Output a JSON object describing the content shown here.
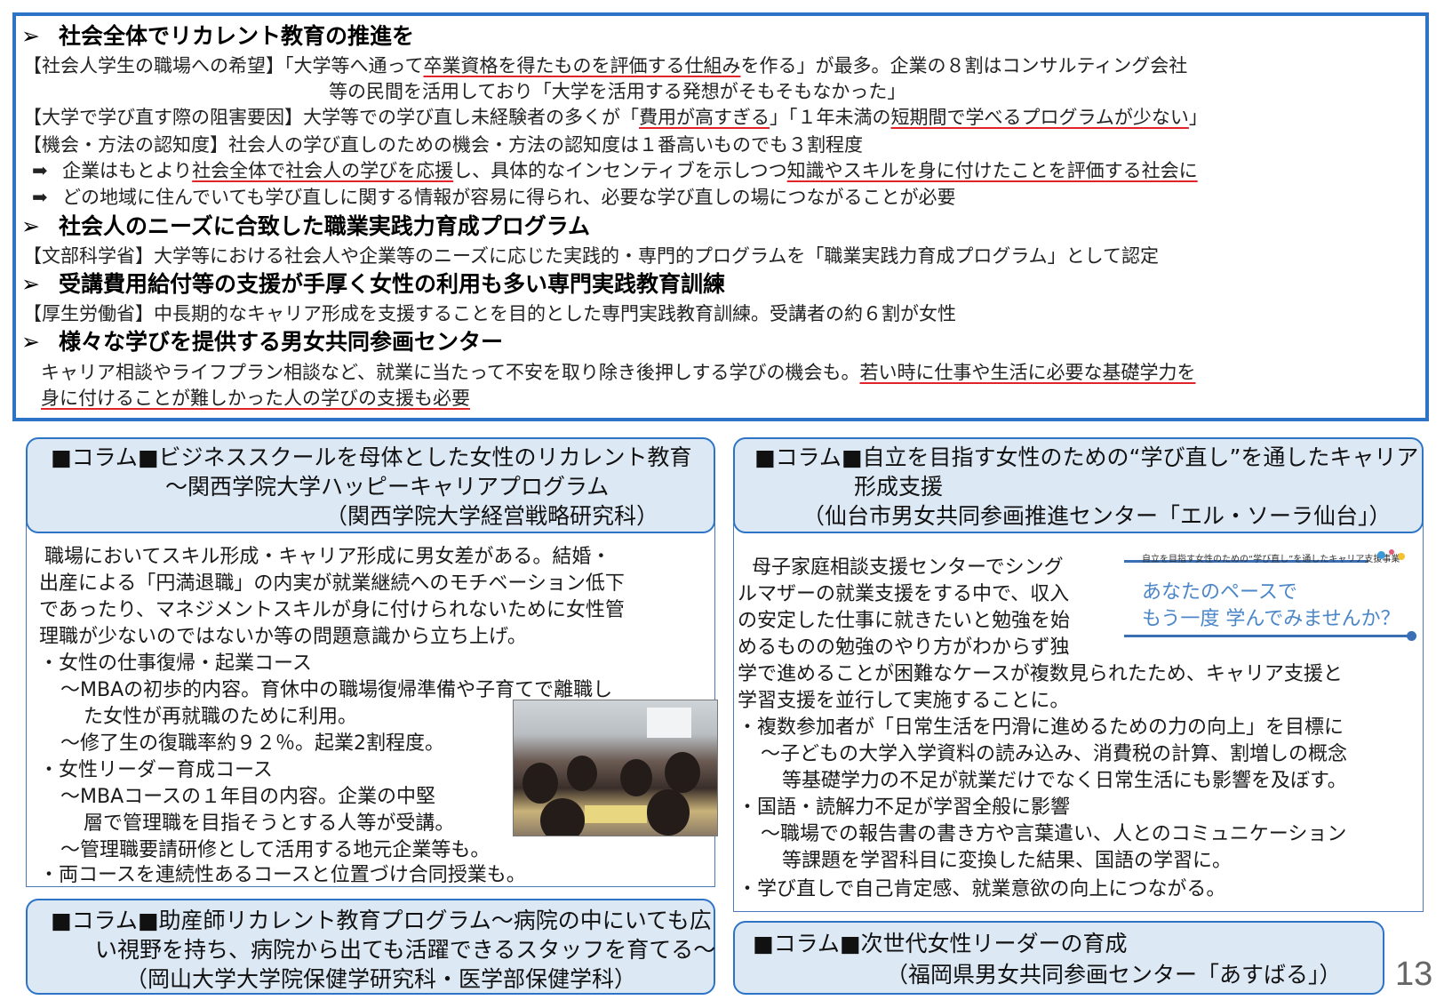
{
  "top": {
    "h1": "社会全体でリカレント教育の推進を",
    "l1a": "【社会人学生の職場への希望】「大学等へ通って",
    "l1u": "卒業資格を得たものを評価する仕組み",
    "l1b": "を作る」が最多。企業の８割はコンサルティング会社",
    "l2": "等の民間を活用しており「大学を活用する発想がそもそもなかった」",
    "l3a": "【大学で学び直す際の阻害要因】大学等での学び直し未経験者の多くが「",
    "l3u1": "費用が高すぎる",
    "l3b": "」「１年未満の",
    "l3u2": "短期間で学べるプログラムが少ない",
    "l3c": "」",
    "l4": "【機会・方法の認知度】社会人の学び直しのための機会・方法の認知度は１番高いものでも３割程度",
    "arrow": "➡",
    "l5a": "企業はもとより",
    "l5u1": "社会全体で社会人の学びを応援",
    "l5b": "し、具体的なインセンティブを示しつつ",
    "l5u2": "知識やスキルを身に付けたことを評価する社会に",
    "l6": "どの地域に住んでいても学び直しに関する情報が容易に得られ、必要な学び直しの場につながることが必要",
    "h2": "社会人のニーズに合致した職業実践力育成プログラム",
    "l7": "【文部科学省】大学等における社会人や企業等のニーズに応じた実践的・専門的プログラムを「職業実践力育成プログラム」として認定",
    "h3": "受講費用給付等の支援が手厚く女性の利用も多い専門実践教育訓練",
    "l8": "【厚生労働省】中長期的なキャリア形成を支援することを目的とした専門実践教育訓練。受講者の約６割が女性",
    "h4": "様々な学びを提供する男女共同参画センター",
    "l9a": "キャリア相談やライフプラン相談など、就業に当たって不安を取り除き後押しする学びの機会も。",
    "l9u": "若い時に仕事や生活に必要な基礎学力を",
    "l10u": "身に付けることが難しかった人の学びの支援も必要",
    "bullet": "➢"
  },
  "left": {
    "head1": "■コラム■ビジネススクールを母体とした女性のリカレント教育",
    "head2": "～関西学院大学ハッピーキャリアプログラム",
    "head3": "（関西学院大学経営戦略研究科）",
    "b1": "職場においてスキル形成・キャリア形成に男女差がある。結婚・",
    "b2": "出産による「円満退職」の内実が就業継続へのモチベーション低下",
    "b3": "であったり、マネジメントスキルが身に付けられないために女性管",
    "b4": "理職が少ないのではないか等の問題意識から立ち上げ。",
    "b5": "・女性の仕事復帰・起業コース",
    "b6": "～MBAの初歩的内容。育休中の職場復帰準備や子育てで離職し",
    "b7": "た女性が再就職のために利用。",
    "b8": "～修了生の復職率約９２％。起業2割程度。",
    "b9": "・女性リーダー育成コース",
    "b10": "～MBAコースの１年目の内容。企業の中堅",
    "b11": "層で管理職を目指そうとする人等が受講。",
    "b12": "～管理職要請研修として活用する地元企業等も。",
    "b13": "・両コースを連続性あるコースと位置づけ合同授業も。",
    "col2_1": "■コラム■助産師リカレント教育プログラム～病院の中にいても広",
    "col2_2": "い視野を持ち、病院から出ても活躍できるスタッフを育てる～",
    "col2_3": "（岡山大学大学院保健学研究科・医学部保健学科）"
  },
  "right": {
    "head1": "■コラム■自立を目指す女性のための“学び直し”を通したキャリア",
    "head2": "形成支援",
    "head3": "（仙台市男女共同参画推進センター「エル・ソーラ仙台」）",
    "b1": "母子家庭相談支援センターでシング",
    "b2": "ルマザーの就業支援をする中で、収入",
    "b3": "の安定した仕事に就きたいと勉強を始",
    "b4": "めるものの勉強のやり方がわからず独",
    "b5": "学で進めることが困難なケースが複数見られたため、キャリア支援と",
    "b6": "学習支援を並行して実施することに。",
    "b7": "・複数参加者が「日常生活を円滑に進めるための力の向上」を目標に",
    "b8": "～子どもの大学入学資料の読み込み、消費税の計算、割増しの概念",
    "b9": "等基礎学力の不足が就業だけでなく日常生活にも影響を及ぼす。",
    "b10": "・国語・読解力不足が学習全般に影響",
    "b11": "～職場での報告書の書き方や言葉遣い、人とのコミュニケーション",
    "b12": "等課題を学習科目に変換した結果、国語の学習に。",
    "b13": "・学び直しで自己肯定感、就業意欲の向上につながる。",
    "banner_small": "自立を目指す女性のための“学び直し”を通したキャリア支援事業",
    "banner_l1": "あなたのペースで",
    "banner_l2": "もう一度 学んでみませんか？",
    "col2_1": "■コラム■次世代女性リーダーの育成",
    "col2_2": "（福岡県男女共同参画センター「あすばる」）"
  },
  "page_number": "13",
  "colors": {
    "border_blue": "#2e74c6",
    "header_fill": "#dde8f5",
    "underline_red": "#e0242a"
  }
}
